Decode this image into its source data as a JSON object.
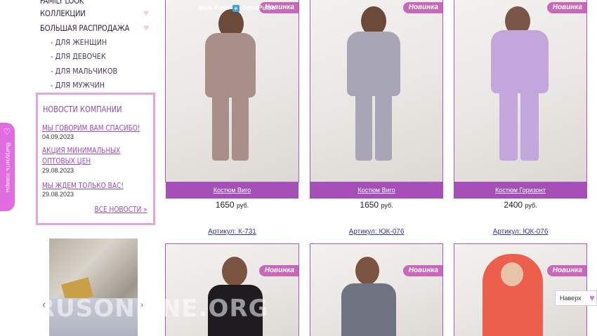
{
  "sidebar": {
    "menu": [
      {
        "label": "FAMILY LOOK"
      },
      {
        "label": "КОЛЛЕКЦИИ"
      },
      {
        "label": "БОЛЬШАЯ РАСПРОДАЖА"
      }
    ],
    "submenu": [
      {
        "label": "- ДЛЯ ЖЕНЩИН"
      },
      {
        "label": "- ДЛЯ ДЕВОЧЕК"
      },
      {
        "label": "- ДЛЯ МАЛЬЧИКОВ"
      },
      {
        "label": "- ДЛЯ МУЖЧИН"
      }
    ],
    "news": {
      "title": "НОВОСТИ КОМПАНИИ",
      "items": [
        {
          "title": "МЫ ГОВОРИМ ВАМ СПАСИБО!",
          "date": "04.09.2023"
        },
        {
          "title": "АКЦИЯ МИНИМАЛЬНЫХ ОПТОВЫХ ЦЕН",
          "date": "29.08.2023"
        },
        {
          "title": "МЫ ЖДЕМ ТОЛЬКО ВАС!",
          "date": "29.08.2023"
        }
      ],
      "all_link": "ВСЕ НОВОСТИ »"
    },
    "export_tab": "Выгрузить товары"
  },
  "webpush": {
    "left": "Web Push",
    "right": "SendPulse"
  },
  "watermark": "RUSONLINE.ORG",
  "to_top": "Наверх",
  "products": [
    {
      "badge": "Новинка",
      "name": "Костюм Виго",
      "price": "1650",
      "currency": "руб.",
      "sku": "Артикул: К-731",
      "color": "#a89088"
    },
    {
      "badge": "Новинка",
      "name": "Костюм Виго",
      "price": "1650",
      "currency": "руб.",
      "sku": "Артикул: ЮК-076",
      "color": "#a8a5b6"
    },
    {
      "badge": "Новинка",
      "name": "Костюм Горизонт",
      "price": "2400",
      "currency": "руб.",
      "sku": "Артикул: ЮК-076",
      "color": "#c2a6dc"
    },
    {
      "badge": "Новинка",
      "color": "#1e1c1f"
    },
    {
      "badge": "Новинка",
      "color": "#6f7280"
    },
    {
      "badge": "Новинка",
      "color": "#ec5f4c"
    }
  ],
  "colors": {
    "accent": "#a64fb8",
    "news_border": "#e3a6df",
    "export_tab": "#e16ce0"
  }
}
